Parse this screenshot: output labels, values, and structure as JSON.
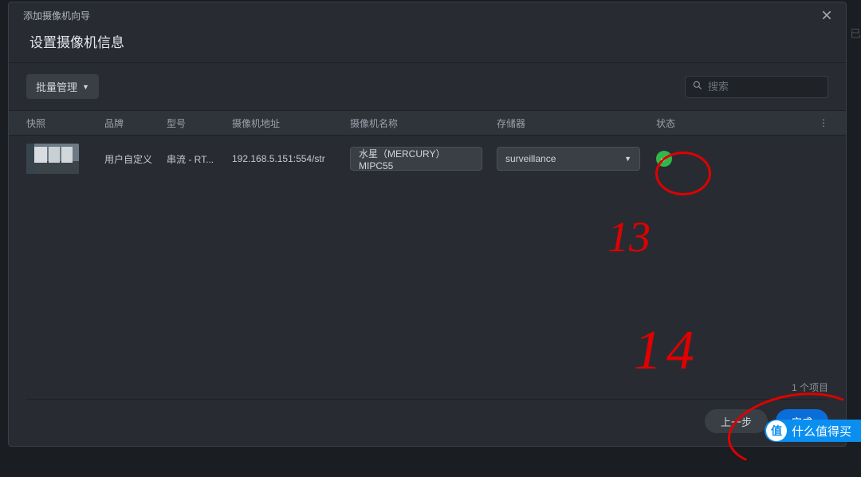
{
  "dialog": {
    "wizard_title": "添加摄像机向导",
    "page_title": "设置摄像机信息"
  },
  "toolbar": {
    "batch_label": "批量管理",
    "search_placeholder": "搜索"
  },
  "columns": {
    "snapshot": "快照",
    "brand": "品牌",
    "model": "型号",
    "address": "摄像机地址",
    "name": "摄像机名称",
    "storage": "存储器",
    "status": "状态",
    "more": "⋮"
  },
  "rows": [
    {
      "brand": "用户自定义",
      "model": "串流 - RT...",
      "address": "192.168.5.151:554/str",
      "name": "水星（MERCURY）MIPC55",
      "storage": "surveillance",
      "status": "ok"
    }
  ],
  "footer": {
    "count": "1 个项目",
    "prev": "上一步",
    "done": "完成"
  },
  "annotations": {
    "note1": "13",
    "note2": "14"
  },
  "watermark": "什么值得买",
  "bg_letter": "已"
}
